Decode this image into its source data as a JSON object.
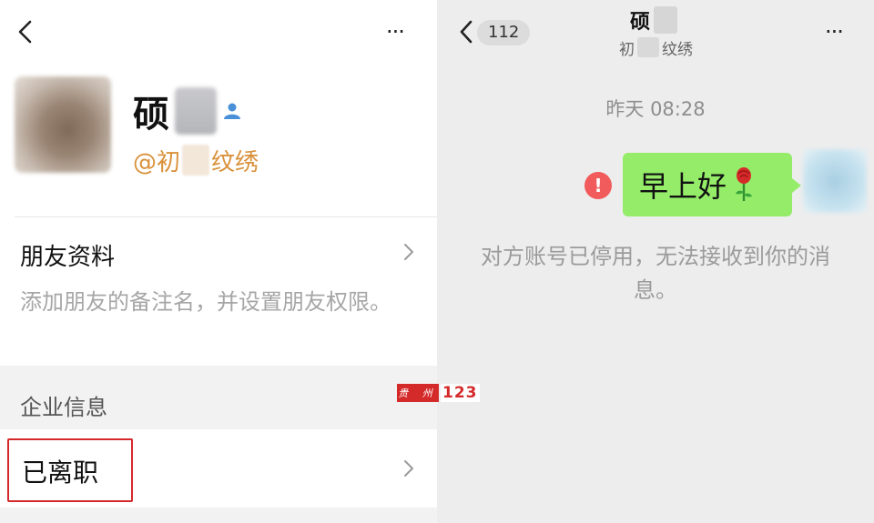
{
  "profile": {
    "more_label": "···",
    "name": "硕",
    "corp_prefix": "@初",
    "corp_suffix": "纹绣",
    "friend_title": "朋友资料",
    "friend_desc": "添加朋友的备注名，并设置朋友权限。",
    "corp_info_label": "企业信息",
    "resigned_label": "已离职"
  },
  "chat": {
    "unread_badge": "112",
    "title": "硕",
    "subtitle_prefix": "初",
    "subtitle_suffix": "纹绣",
    "more_label": "···",
    "timestamp": "昨天 08:28",
    "error_mark": "!",
    "message_text": "早上好",
    "notice": "对方账号已停用，无法接收到你的消息。"
  },
  "watermark": {
    "stamp": "贵 州",
    "number": "123"
  },
  "colors": {
    "bubble": "#95ec69",
    "error": "#f25b5b",
    "corp_orange": "#d9913a",
    "highlight_red": "#d4282b"
  },
  "icons": [
    "back-chevron-icon",
    "more-dots-icon",
    "person-badge-icon",
    "chevron-right-icon",
    "error-icon",
    "rose-emoji-icon"
  ]
}
